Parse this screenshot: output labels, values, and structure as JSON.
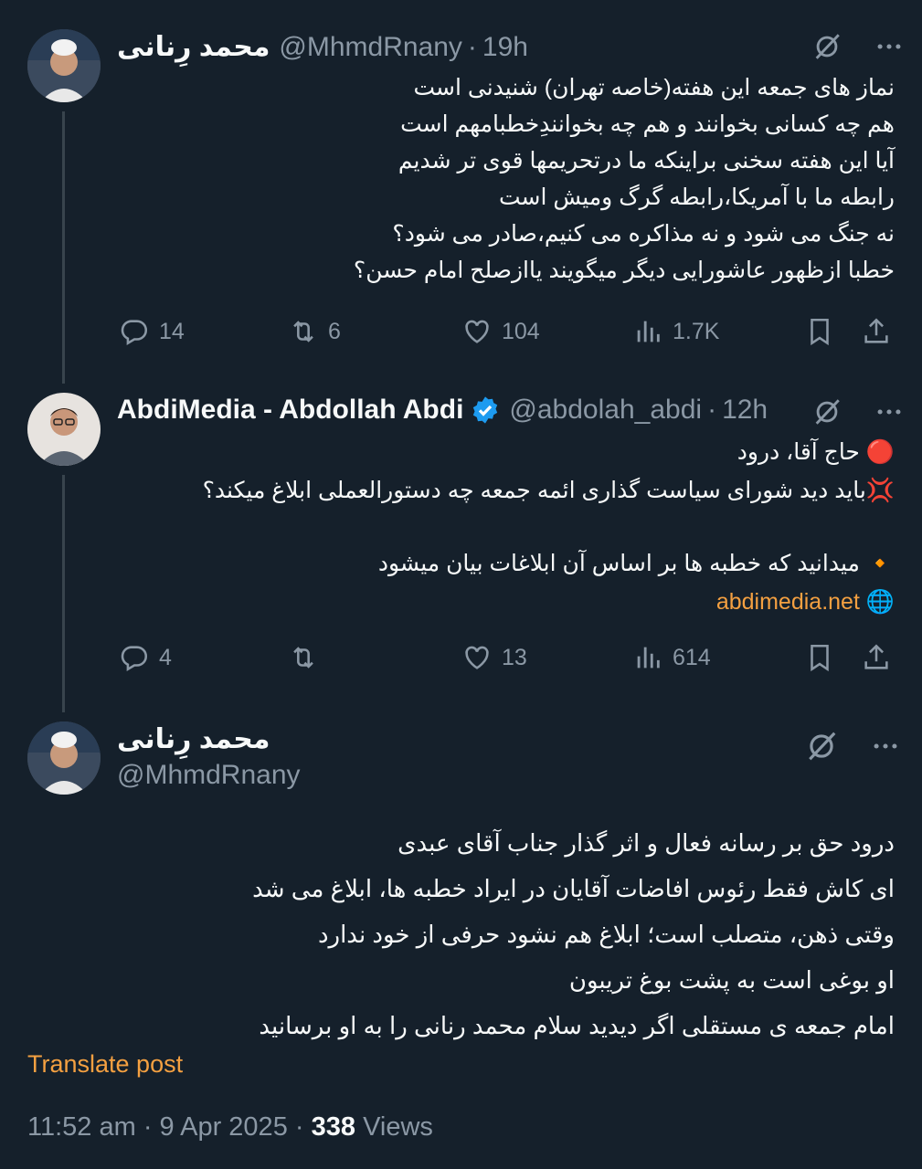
{
  "tweet1": {
    "name": "محمد رِنانی",
    "handle": "@MhmdRnany",
    "separator": "·",
    "time": "19h",
    "lines": [
      "نماز های جمعه این هفته(خاصه تهران) شنیدنی است",
      "هم چه کسانی بخوانند و هم چه بخوانندِخطبامهم است",
      "آیا این هفته سخنی براینکه ما درتحریمها قوی تر شدیم",
      "رابطه ما با آمریکا،رابطه گرگ ومیش است",
      "نه جنگ می شود و نه مذاکره می کنیم،صادر می شود؟",
      "خطبا ازظهور عاشورایی دیگر میگویند یاازصلح امام حسن؟"
    ],
    "replies": "14",
    "reposts": "6",
    "likes": "104",
    "views": "1.7K"
  },
  "tweet2": {
    "name": "AbdiMedia - Abdollah Abdi",
    "handle": "@abdolah_abdi",
    "separator": "·",
    "time": "12h",
    "line1": "حاج آقا، درود",
    "line2": "باید دید شورای سیاست گذاری ائمه جمعه چه دستورالعملی ابلاغ میکند؟",
    "line3": "میدانید که خطبه ها بر اساس آن ابلاغات بیان میشود",
    "link": "abdimedia.net",
    "replies": "4",
    "likes": "13",
    "views": "614",
    "emoji": {
      "red_circle": "🔴",
      "anger": "💢",
      "diamond": "🔸",
      "globe": "🌐"
    }
  },
  "tweet3": {
    "name": "محمد رِنانی",
    "handle": "@MhmdRnany",
    "lines": [
      "درود حق بر رسانه فعال و اثر گذار جناب آقای عبدی",
      "ای کاش فقط رئوس افاضات آقایان در ایراد خطبه ها، ابلاغ می شد",
      "وقتی ذهن، متصلب است؛ ابلاغ هم نشود حرفی از خود ندارد",
      "او بوغی است به پشت بوغ تریبون",
      "امام جمعه ی مستقلی اگر دیدید سلام محمد رنانی را به او برسانید"
    ],
    "translate": "Translate post",
    "timestamp": "11:52 am · 9 Apr 2025 ·",
    "view_count": "338",
    "views_label": "Views"
  },
  "colors": {
    "background": "#15202b",
    "text": "#f7f9f9",
    "muted": "#8b98a5",
    "accent": "#f4a041",
    "verified": "#1d9bf0"
  },
  "icons": [
    "grok-icon",
    "more-icon",
    "reply-icon",
    "repost-icon",
    "like-icon",
    "views-icon",
    "bookmark-icon",
    "share-icon",
    "verified-badge-icon"
  ]
}
